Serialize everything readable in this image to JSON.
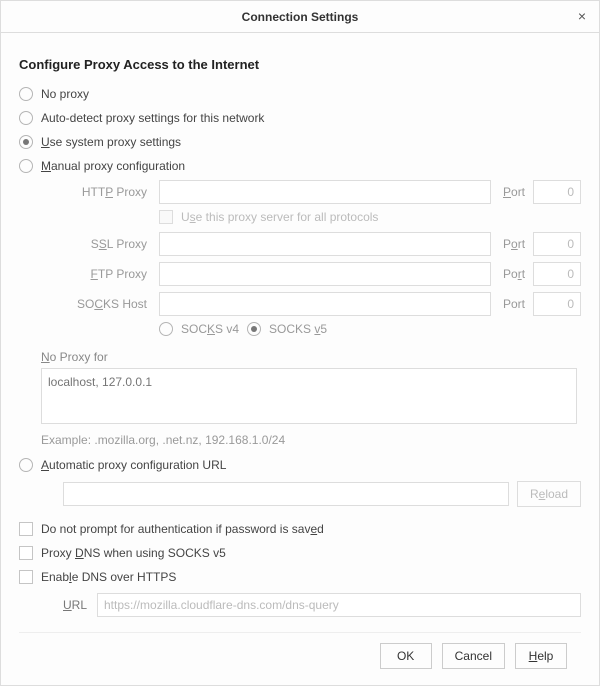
{
  "title": "Connection Settings",
  "sectionTitle": "Configure Proxy Access to the Internet",
  "radios": {
    "noProxy": "No proxy",
    "autoDetect": "Auto-detect proxy settings for this network",
    "systemPre": "",
    "systemMn": "U",
    "systemPost": "se system proxy settings",
    "manualMn": "M",
    "manualPost": "anual proxy configuration",
    "autoUrlMn": "A",
    "autoUrlPost": "utomatic proxy configuration URL"
  },
  "proxy": {
    "httpLabelMn": "P",
    "httpLabelPre": "HTT",
    "httpLabelPost": " Proxy",
    "sslLabelMn": "S",
    "sslLabelPre": "S",
    "sslLabelPost": "L Proxy",
    "ftpLabelMn": "F",
    "ftpLabelPost": "TP Proxy",
    "socksLabelMn": "C",
    "socksLabelPre": "SO",
    "socksLabelPost": "KS Host",
    "portMn": "P",
    "portPost": "ort",
    "portMnO": "o",
    "portPreP": "P",
    "portPostRt": "rt",
    "portMnR": "r",
    "portPrePo": "Po",
    "portPostT": "t",
    "portPlainPort": "Port",
    "zero": "0",
    "allProtoPre": "U",
    "allProtoMn": "s",
    "allProtoPost": "e this proxy server for all protocols",
    "socksV4Pre": "SOC",
    "socksV4Mn": "K",
    "socksV4Post": "S v4",
    "socksV5Pre": "SOCKS ",
    "socksV5Mn": "v",
    "socksV5Post": "5",
    "noProxyMn": "N",
    "noProxyPost": "o Proxy for",
    "noProxyPlaceholder": "localhost, 127.0.0.1",
    "example": "Example: .mozilla.org, .net.nz, 192.168.1.0/24"
  },
  "reloadPre": "R",
  "reloadMn": "e",
  "reloadPost": "load",
  "checks": {
    "noPromptPre": "Do not prompt for authentication if password is sav",
    "noPromptMn": "e",
    "noPromptPost": "d",
    "proxyDnsPre": "Proxy ",
    "proxyDnsMn": "D",
    "proxyDnsPost": "NS when using SOCKS v5",
    "enableDohPre": "Enab",
    "enableDohMn": "l",
    "enableDohPost": "e DNS over HTTPS",
    "urlLabelMn": "U",
    "urlLabelPost": "RL",
    "dohPlaceholder": "https://mozilla.cloudflare-dns.com/dns-query"
  },
  "buttons": {
    "ok": "OK",
    "cancel": "Cancel",
    "helpMn": "H",
    "helpPost": "elp"
  }
}
